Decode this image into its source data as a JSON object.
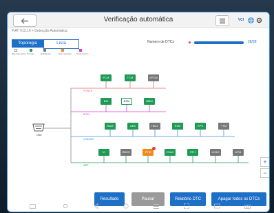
{
  "header": {
    "title": "Verificação automática",
    "status_text": "VCI"
  },
  "breadcrumb": "FIAT V12.10 > Detecção Automática",
  "tabs": [
    {
      "label": "Topologia"
    },
    {
      "label": "Lista"
    }
  ],
  "dtc": {
    "label": "Numero de DTCs",
    "progress_text": "28/28",
    "progress_fraction": 1.0
  },
  "legend": [
    {
      "label": "Não responsivo",
      "color": "#ffffff"
    },
    {
      "label": "Normal",
      "color": "#1f9a55"
    },
    {
      "label": "Deficiência",
      "color": "#777777"
    },
    {
      "label": "Sem resposta",
      "color": "#f08a1c"
    },
    {
      "label": "Sinal externo",
      "color": "#d53cd8"
    }
  ],
  "obd_label": "OBD",
  "buses": [
    {
      "label": "POWER",
      "color": "#e06a6a"
    },
    {
      "label": "BODY",
      "color": "#d53cd8"
    },
    {
      "label": "CHASSIS",
      "color": "#3a8fd6"
    },
    {
      "label": "INFT",
      "color": "#1f9a55"
    }
  ],
  "modules": {
    "row1": [
      {
        "label": "PCM",
        "state": "green"
      },
      {
        "label": "TCM",
        "state": "green"
      },
      {
        "label": "EPCM",
        "state": "gray"
      }
    ],
    "row2": [
      {
        "label": "BSI",
        "state": "green"
      },
      {
        "label": "BSM",
        "state": "white"
      },
      {
        "label": "BMM",
        "state": "green"
      }
    ],
    "row3": [
      {
        "label": "RAM",
        "state": "green"
      },
      {
        "label": "ABS",
        "state": "green"
      },
      {
        "label": "HALT",
        "state": "gray"
      },
      {
        "label": "ESM",
        "state": "green"
      },
      {
        "label": "EPS",
        "state": "green"
      },
      {
        "label": "TTM",
        "state": "gray"
      }
    ],
    "row4": [
      {
        "label": "IC",
        "state": "green"
      },
      {
        "label": "RBSS",
        "state": "gray"
      },
      {
        "label": "PTM",
        "state": "orange"
      },
      {
        "label": "HVAC",
        "state": "green"
      },
      {
        "label": "RFH",
        "state": "green"
      },
      {
        "label": "LDSO",
        "state": "gray"
      },
      {
        "label": "APM",
        "state": "gray"
      }
    ]
  },
  "zoom": {
    "in": "+",
    "out": "−"
  },
  "buttons": [
    {
      "label": "Resultado",
      "style": "blue"
    },
    {
      "label": "Pausar",
      "style": "gray"
    },
    {
      "label": "Relatório DTC",
      "style": "blue"
    },
    {
      "label": "Apagar todos os DTCs",
      "style": "blue"
    }
  ],
  "icons": {
    "back": "back-arrow-icon",
    "menu": "menu-icon",
    "vci": "vci-icon",
    "globe": "globe-icon",
    "settings": "gear-icon"
  }
}
